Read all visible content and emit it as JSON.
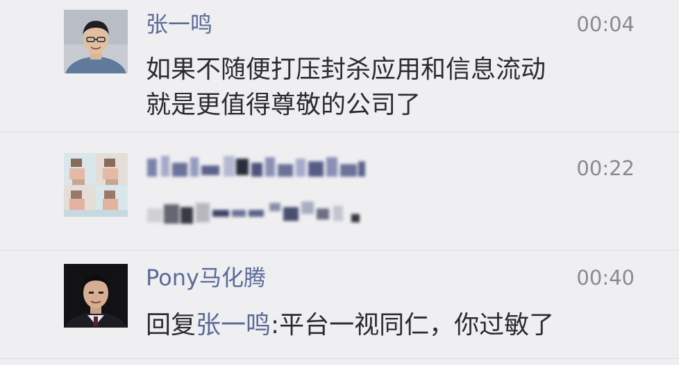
{
  "comments": [
    {
      "name": "张一鸣",
      "time": "00:04",
      "line1": "如果不随便打压封杀应用和信息流动",
      "line2": "就是更值得尊敬的公司了"
    },
    {
      "name": "",
      "time": "00:22",
      "line1": "",
      "line2": ""
    },
    {
      "name": "Pony马化腾",
      "time": "00:40",
      "reply_prefix": "回复",
      "reply_to": "张一鸣",
      "reply_text": ":平台一视同仁，你过敏了"
    }
  ]
}
